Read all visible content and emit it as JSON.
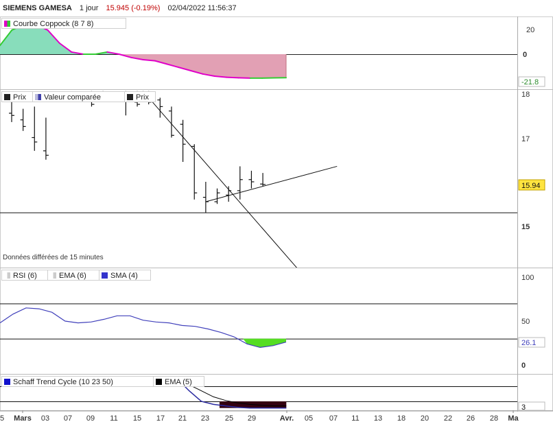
{
  "header": {
    "ticker": "SIEMENS GAMESA",
    "period": "1 jour",
    "change": "15.945 (-0.19%)",
    "datetime": "02/04/2022 11:56:37"
  },
  "colors": {
    "up": "#33cc33",
    "down": "#e000c8",
    "pos_fill": "#88ddbb",
    "neg_fill": "#e2a0b4",
    "rsi": "#4040bb",
    "rsi_fill": "#55dd22",
    "schaff": "#2a2aa0",
    "schaff_fill": "#330011",
    "price_label_bg": "#ffe440"
  },
  "coppock": {
    "legend": "Courbe Coppock (8 7 8)",
    "last_label": "-21.8",
    "ticks": [
      "20",
      "0"
    ],
    "chart_data": {
      "type": "area",
      "title": "Courbe Coppock (8 7 8)",
      "x_index": [
        0,
        1,
        2,
        3,
        4,
        5,
        6,
        7,
        8,
        9,
        10,
        11,
        12,
        13,
        14,
        15,
        16,
        17,
        18,
        19,
        20,
        21,
        22,
        23,
        24
      ],
      "values": [
        8,
        22,
        27,
        27,
        22,
        10,
        2,
        0,
        0,
        2,
        0,
        -3,
        -5,
        -6,
        -9,
        -12,
        -15,
        -18,
        -20,
        -21,
        -21.5,
        -21.8,
        -21.8,
        -21.6,
        -21.4
      ],
      "ylim": [
        -28,
        28
      ],
      "zero_line": 0
    }
  },
  "price": {
    "legends": [
      {
        "label": "Prix",
        "color": "#222222"
      },
      {
        "label": "Valeur comparée",
        "color": "#8888cc"
      },
      {
        "label": "Prix",
        "color": "#222222"
      }
    ],
    "last_label": "15.94",
    "ticks": [
      "18",
      "17",
      "15"
    ],
    "delay_note": "Données différées de 15 minutes",
    "chart_data": {
      "type": "bar",
      "subtype": "ohlc",
      "ylim": [
        14.05,
        18.05
      ],
      "bars": [
        {
          "i": 0,
          "o": 17.55,
          "h": 17.8,
          "l": 17.35,
          "c": 17.5
        },
        {
          "i": 1,
          "o": 17.4,
          "h": 17.65,
          "l": 17.15,
          "c": 17.25
        },
        {
          "i": 2,
          "o": 17.0,
          "h": 17.7,
          "l": 16.7,
          "c": 16.9
        },
        {
          "i": 3,
          "o": 16.7,
          "h": 17.45,
          "l": 16.5,
          "c": 16.6
        },
        {
          "i": 7,
          "o": 17.85,
          "h": 18.05,
          "l": 17.7,
          "c": 17.75
        },
        {
          "i": 8,
          "o": 18.0,
          "h": 18.05,
          "l": 17.8,
          "c": 17.9
        },
        {
          "i": 10,
          "o": 17.95,
          "h": 18.05,
          "l": 17.5,
          "c": 17.85
        },
        {
          "i": 11,
          "o": 17.8,
          "h": 18.05,
          "l": 17.7,
          "c": 17.75
        },
        {
          "i": 12,
          "o": 17.95,
          "h": 18.05,
          "l": 17.75,
          "c": 17.8
        },
        {
          "i": 13,
          "o": 17.85,
          "h": 17.9,
          "l": 17.45,
          "c": 17.7
        },
        {
          "i": 14,
          "o": 17.6,
          "h": 17.7,
          "l": 17.0,
          "c": 17.05
        },
        {
          "i": 15,
          "o": 17.3,
          "h": 17.4,
          "l": 16.45,
          "c": 16.85
        },
        {
          "i": 16,
          "o": 16.8,
          "h": 16.85,
          "l": 15.6,
          "c": 15.75
        },
        {
          "i": 17,
          "o": 15.65,
          "h": 16.0,
          "l": 15.3,
          "c": 15.55
        },
        {
          "i": 18,
          "o": 15.55,
          "h": 15.85,
          "l": 15.5,
          "c": 15.75
        },
        {
          "i": 19,
          "o": 15.7,
          "h": 15.9,
          "l": 15.55,
          "c": 15.8
        },
        {
          "i": 20,
          "o": 15.8,
          "h": 16.35,
          "l": 15.6,
          "c": 16.05
        },
        {
          "i": 21,
          "o": 16.05,
          "h": 16.25,
          "l": 15.85,
          "c": 16.0
        },
        {
          "i": 22,
          "o": 15.95,
          "h": 16.2,
          "l": 15.9,
          "c": 15.94
        }
      ],
      "hlines": [
        15.3
      ],
      "trendlines": [
        {
          "x": [
            11.5,
            25
          ],
          "y": [
            18.05,
            14.05
          ]
        },
        {
          "x": [
            17,
            28.5
          ],
          "y": [
            15.55,
            16.35
          ]
        }
      ]
    }
  },
  "rsi": {
    "legends": [
      {
        "label": "RSI (6)",
        "color": ""
      },
      {
        "label": "EMA (6)",
        "color": ""
      },
      {
        "label": "SMA (4)",
        "color": "#3333cc"
      }
    ],
    "last_label": "26.1",
    "ticks": [
      "100",
      "50",
      "0"
    ],
    "chart_data": {
      "type": "line",
      "title": "RSI (6)",
      "x_index": [
        0,
        1,
        2,
        3,
        4,
        5,
        6,
        7,
        8,
        9,
        10,
        11,
        12,
        13,
        14,
        15,
        16,
        17,
        18,
        19,
        20,
        21,
        22
      ],
      "values": [
        48,
        58,
        65,
        64,
        60,
        50,
        48,
        49,
        52,
        56,
        56,
        51,
        49,
        48,
        45,
        44,
        41,
        37,
        32,
        24,
        20,
        22,
        26.1
      ],
      "ylim": [
        -8,
        110
      ],
      "levels": [
        70,
        30
      ]
    }
  },
  "schaff": {
    "legends": [
      {
        "label": "Schaff Trend Cycle (10 23 50)",
        "color": "#1111cc"
      },
      {
        "label": "EMA (5)",
        "color": "#000000"
      }
    ],
    "last_label": "3",
    "chart_data": {
      "type": "line",
      "title": "Schaff Trend Cycle (10 23 50)",
      "series": [
        {
          "name": "Schaff Trend Cycle (10 23 50)",
          "x": [
            13,
            14,
            15,
            16,
            17,
            18,
            19,
            20,
            21,
            22
          ],
          "values": [
            100,
            60,
            25,
            15,
            10,
            5,
            3,
            3,
            3,
            3
          ]
        },
        {
          "name": "EMA (5)",
          "x": [
            13,
            14,
            15,
            16,
            17,
            18,
            19,
            20,
            21,
            22
          ],
          "values": [
            100,
            80,
            60,
            40,
            28,
            20,
            15,
            12,
            10,
            10
          ]
        }
      ],
      "ylim": [
        0,
        100
      ],
      "levels": [
        75,
        25
      ]
    }
  },
  "xaxis": {
    "labels": [
      "5",
      "Mars",
      "03",
      "07",
      "09",
      "11",
      "15",
      "17",
      "21",
      "23",
      "25",
      "29",
      "Avr.",
      "05",
      "07",
      "11",
      "13",
      "18",
      "20",
      "22",
      "26",
      "28",
      "Ma"
    ],
    "bold": [
      "Mars",
      "Avr.",
      "Ma"
    ]
  }
}
